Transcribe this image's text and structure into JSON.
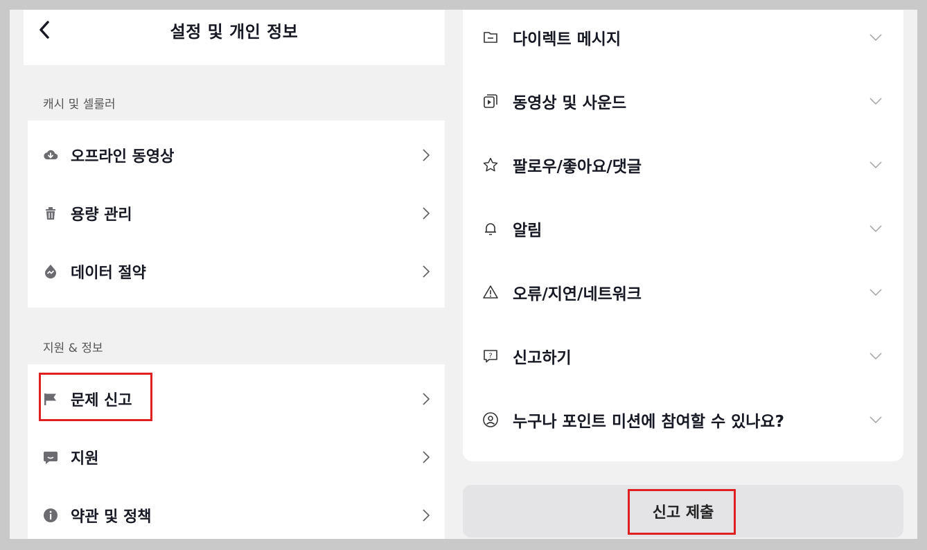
{
  "header": {
    "title": "설정 및 개인 정보"
  },
  "cache_section": {
    "label": "캐시 및 셀룰러",
    "items": [
      {
        "label": "오프라인 동영상",
        "icon": "cloud-download-icon"
      },
      {
        "label": "용량 관리",
        "icon": "trash-icon"
      },
      {
        "label": "데이터 절약",
        "icon": "data-saver-icon"
      }
    ]
  },
  "support_section": {
    "label": "지원 & 정보",
    "items": [
      {
        "label": "문제 신고",
        "icon": "flag-icon"
      },
      {
        "label": "지원",
        "icon": "chat-bubble-icon"
      },
      {
        "label": "약관 및 정책",
        "icon": "info-icon"
      }
    ]
  },
  "faq": {
    "items": [
      {
        "label": "다이렉트 메시지",
        "icon": "folder-icon"
      },
      {
        "label": "동영상 및 사운드",
        "icon": "video-play-icon"
      },
      {
        "label": "팔로우/좋아요/댓글",
        "icon": "star-icon"
      },
      {
        "label": "알림",
        "icon": "bell-icon"
      },
      {
        "label": "오류/지연/네트워크",
        "icon": "warning-icon"
      },
      {
        "label": "신고하기",
        "icon": "report-icon"
      },
      {
        "label": "누구나 포인트 미션에 참여할 수 있나요?",
        "icon": "user-circle-icon"
      }
    ]
  },
  "submit": {
    "label": "신고 제출"
  },
  "colors": {
    "highlight": "#e02020",
    "text": "#161823",
    "background": "#f1f1f2"
  }
}
